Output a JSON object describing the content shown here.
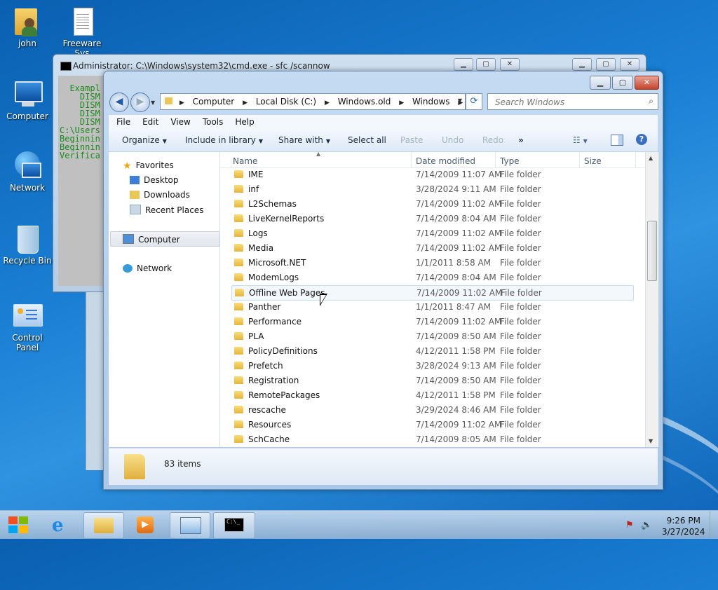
{
  "desktop": {
    "icons": [
      {
        "label": "john"
      },
      {
        "label": "Freeware Sys"
      },
      {
        "label": "Computer"
      },
      {
        "label": "Network"
      },
      {
        "label": "Recycle Bin"
      },
      {
        "label": "Control Panel"
      }
    ]
  },
  "cmd": {
    "title": "Administrator: C:\\Windows\\system32\\cmd.exe - sfc  /scannow",
    "lines": [
      "  Exampl",
      "    DISM",
      "    DISM",
      "    DISM",
      "    DISM",
      "",
      "",
      "C:\\Users",
      "",
      "Beginnin",
      "",
      "Beginnin",
      "Verifica"
    ]
  },
  "explorer": {
    "breadcrumbs": [
      "Computer",
      "Local Disk (C:)",
      "Windows.old",
      "Windows"
    ],
    "search_placeholder": "Search Windows",
    "menu": [
      "File",
      "Edit",
      "View",
      "Tools",
      "Help"
    ],
    "toolbar": {
      "organize": "Organize",
      "include": "Include in library",
      "share": "Share with",
      "select_all": "Select all",
      "paste": "Paste",
      "undo": "Undo",
      "redo": "Redo",
      "more": "»"
    },
    "nav": {
      "favorites": "Favorites",
      "desktop": "Desktop",
      "downloads": "Downloads",
      "recent": "Recent Places",
      "computer": "Computer",
      "network": "Network"
    },
    "columns": {
      "name": "Name",
      "date": "Date modified",
      "type": "Type",
      "size": "Size"
    },
    "rows": [
      {
        "name": "IME",
        "date": "7/14/2009 11:07 AM",
        "type": "File folder"
      },
      {
        "name": "inf",
        "date": "3/28/2024 9:11 AM",
        "type": "File folder"
      },
      {
        "name": "L2Schemas",
        "date": "7/14/2009 11:02 AM",
        "type": "File folder"
      },
      {
        "name": "LiveKernelReports",
        "date": "7/14/2009 8:04 AM",
        "type": "File folder"
      },
      {
        "name": "Logs",
        "date": "7/14/2009 11:02 AM",
        "type": "File folder"
      },
      {
        "name": "Media",
        "date": "7/14/2009 11:02 AM",
        "type": "File folder"
      },
      {
        "name": "Microsoft.NET",
        "date": "1/1/2011 8:58 AM",
        "type": "File folder"
      },
      {
        "name": "ModemLogs",
        "date": "7/14/2009 8:04 AM",
        "type": "File folder"
      },
      {
        "name": "Offline Web Pages",
        "date": "7/14/2009 11:02 AM",
        "type": "File folder"
      },
      {
        "name": "Panther",
        "date": "1/1/2011 8:47 AM",
        "type": "File folder"
      },
      {
        "name": "Performance",
        "date": "7/14/2009 11:02 AM",
        "type": "File folder"
      },
      {
        "name": "PLA",
        "date": "7/14/2009 8:50 AM",
        "type": "File folder"
      },
      {
        "name": "PolicyDefinitions",
        "date": "4/12/2011 1:58 PM",
        "type": "File folder"
      },
      {
        "name": "Prefetch",
        "date": "3/28/2024 9:13 AM",
        "type": "File folder"
      },
      {
        "name": "Registration",
        "date": "7/14/2009 8:50 AM",
        "type": "File folder"
      },
      {
        "name": "RemotePackages",
        "date": "4/12/2011 1:58 PM",
        "type": "File folder"
      },
      {
        "name": "rescache",
        "date": "3/29/2024 8:46 AM",
        "type": "File folder"
      },
      {
        "name": "Resources",
        "date": "7/14/2009 11:02 AM",
        "type": "File folder"
      },
      {
        "name": "SchCache",
        "date": "7/14/2009 8:05 AM",
        "type": "File folder"
      }
    ],
    "status": "83 items"
  },
  "taskbar": {
    "time": "9:26 PM",
    "date": "3/27/2024"
  }
}
